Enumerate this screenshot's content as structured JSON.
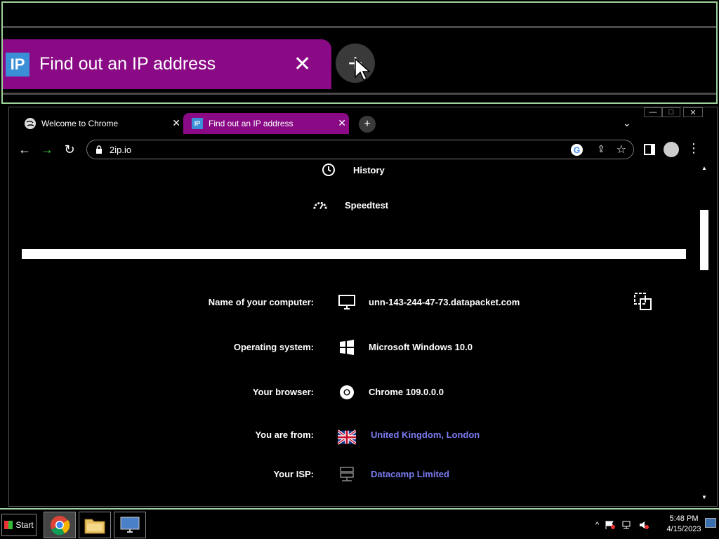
{
  "zoom": {
    "tab_favicon": "IP",
    "tab_title": "Find out an IP address",
    "tab_close": "✕",
    "newtab_icon": "+"
  },
  "browser": {
    "tabs": [
      {
        "title": "Welcome to Chrome",
        "close": "✕",
        "icon": "globe-icon"
      },
      {
        "title": "Find out an IP address",
        "close": "✕",
        "favicon": "IP",
        "active": true
      }
    ],
    "newtab_icon": "+",
    "tabsearch_icon": "⌄",
    "window_controls": {
      "minimize": "—",
      "maximize": "□",
      "close": "✕"
    },
    "url": "2ip.io",
    "accent_tab_color": "#8a0a86"
  },
  "page": {
    "nav": {
      "history": "History",
      "speedtest": "Speedtest"
    },
    "rows": [
      {
        "label": "Name of your computer:",
        "value": "unn-143-244-47-73.datapacket.com",
        "icon": "monitor-icon"
      },
      {
        "label": "Operating system:",
        "value": "Microsoft Windows 10.0",
        "icon": "windows-icon"
      },
      {
        "label": "Your browser:",
        "value": "Chrome 109.0.0.0",
        "icon": "chrome-icon"
      },
      {
        "label": "You are from:",
        "value": "United Kingdom, London",
        "icon": "uk-flag-icon",
        "link": true
      },
      {
        "label": "Your ISP:",
        "value": "Datacamp Limited",
        "icon": "server-icon",
        "link": true
      }
    ],
    "link_color": "#7b7bf0"
  },
  "taskbar": {
    "start_label": "Start",
    "time": "5:48 PM",
    "date": "4/15/2023",
    "tray_chevron": "^"
  }
}
